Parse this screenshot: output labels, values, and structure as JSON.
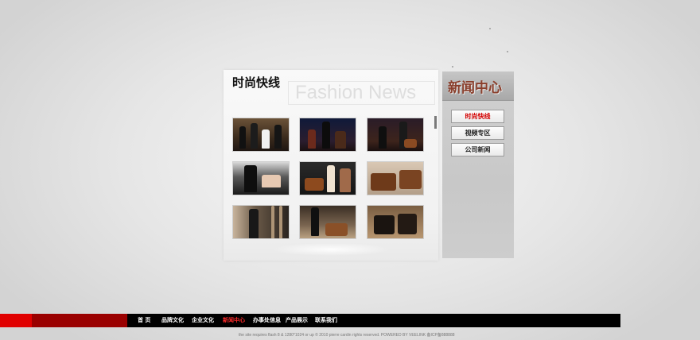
{
  "content": {
    "title": "时尚快线",
    "watermark": "Fashion News"
  },
  "side": {
    "title": "新闻中心",
    "buttons": [
      "时尚快线",
      "视频专区",
      "公司新闻"
    ]
  },
  "nav": {
    "items": [
      "首 页",
      "品牌文化",
      "企业文化",
      "新闻中心",
      "办事处信息",
      "产品展示",
      "联系我们"
    ]
  },
  "footer": {
    "copyright": "the site requires flash 8 & 1280*1024 or up   © 2010 pierre cardin rights reserved. POWERED BY VEELINK   备ICP备888888"
  },
  "colors": {
    "accent_red": "#e00000",
    "dark_red": "#9a0000",
    "active_text": "#d40000",
    "side_title": "#8a3f2c"
  }
}
